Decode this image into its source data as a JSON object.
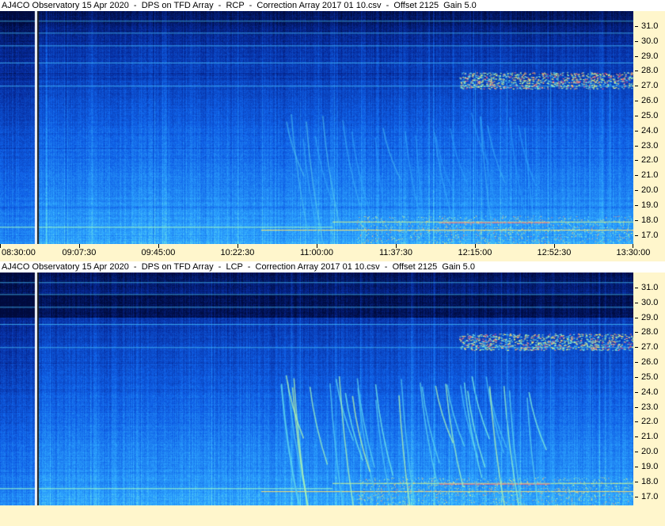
{
  "chart_data": [
    {
      "type": "heatmap",
      "title": "AJ4CO Observatory 15 Apr 2020  -  DPS on TFD Array  -  RCP  -  Correction Array 2017 01 10.csv  -  Offset 2125  Gain 5.0",
      "polarization": "RCP",
      "x_tick_labels": [
        "08:30:00",
        "09:07:30",
        "09:45:00",
        "10:22:30",
        "11:00:00",
        "11:37:30",
        "12:15:00",
        "12:52:30",
        "13:30:00"
      ],
      "y_tick_labels": [
        "31.0",
        "30.0",
        "29.0",
        "28.0",
        "27.0",
        "26.0",
        "25.0",
        "24.0",
        "23.0",
        "22.0",
        "21.0",
        "20.0",
        "19.0",
        "18.0",
        "17.0"
      ],
      "xlim": [
        "08:30:00",
        "13:30:00"
      ],
      "ylim": [
        16.4,
        32.0
      ],
      "colormap": [
        "#000a3c",
        "#062a9a",
        "#0f5fe6",
        "#2ea6ff",
        "#7ff7e0",
        "#ffff66",
        "#ff3a7a"
      ]
    },
    {
      "type": "heatmap",
      "title": "AJ4CO Observatory 15 Apr 2020  -  DPS on TFD Array  -  LCP  -  Correction Array 2017 01 10.csv  -  Offset 2125  Gain 5.0",
      "polarization": "LCP",
      "x_tick_labels": [],
      "y_tick_labels": [
        "31.0",
        "30.0",
        "29.0",
        "28.0",
        "27.0",
        "26.0",
        "25.0",
        "24.0",
        "23.0",
        "22.0",
        "21.0",
        "20.0",
        "19.0",
        "18.0",
        "17.0"
      ],
      "xlim": [
        "08:30:00",
        "13:30:00"
      ],
      "ylim": [
        16.4,
        32.0
      ],
      "colormap": [
        "#000a3c",
        "#062a9a",
        "#0f5fe6",
        "#2ea6ff",
        "#7ff7e0",
        "#ffff66",
        "#ff3a7a"
      ]
    }
  ]
}
